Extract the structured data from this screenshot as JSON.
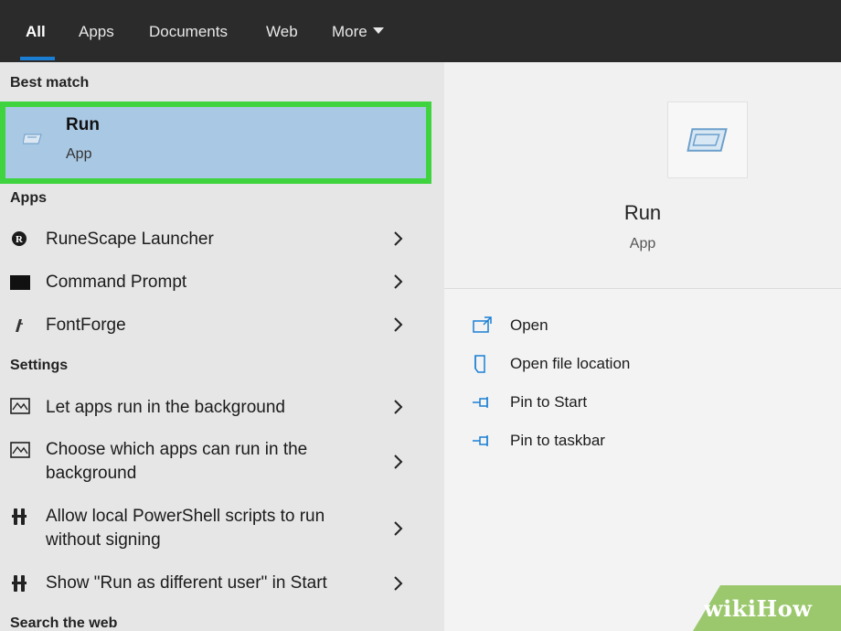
{
  "tabs": [
    {
      "label": "All",
      "active": true
    },
    {
      "label": "Apps"
    },
    {
      "label": "Documents"
    },
    {
      "label": "Web"
    },
    {
      "label": "More"
    }
  ],
  "sections": {
    "best_match": "Best match",
    "apps": "Apps",
    "settings": "Settings",
    "search_web": "Search the web"
  },
  "best_match": {
    "title": "Run",
    "subtitle": "App"
  },
  "apps": [
    {
      "label": "RuneScape Launcher",
      "icon": "runescape-icon"
    },
    {
      "label": "Command Prompt",
      "icon": "command-prompt-icon"
    },
    {
      "label": "FontForge",
      "icon": "fontforge-icon"
    }
  ],
  "settings": [
    {
      "label": "Let apps run in the background",
      "icon": "monitor-chart-icon"
    },
    {
      "label": "Choose which apps can run in the background",
      "icon": "monitor-chart-icon"
    },
    {
      "label": "Allow local PowerShell scripts to run without signing",
      "icon": "tools-icon"
    },
    {
      "label": "Show \"Run as different user\" in Start",
      "icon": "tools-icon"
    }
  ],
  "detail": {
    "name": "Run",
    "type": "App",
    "actions": [
      {
        "label": "Open",
        "icon": "open-icon"
      },
      {
        "label": "Open file location",
        "icon": "folder-icon"
      },
      {
        "label": "Pin to Start",
        "icon": "pin-icon"
      },
      {
        "label": "Pin to taskbar",
        "icon": "pin-icon"
      }
    ]
  },
  "watermark": "wikiHow",
  "colors": {
    "accent": "#1a7fd4",
    "highlight": "#3fd43f",
    "selected_bg": "#a9c8e4",
    "topbar": "#2b2b2b"
  }
}
